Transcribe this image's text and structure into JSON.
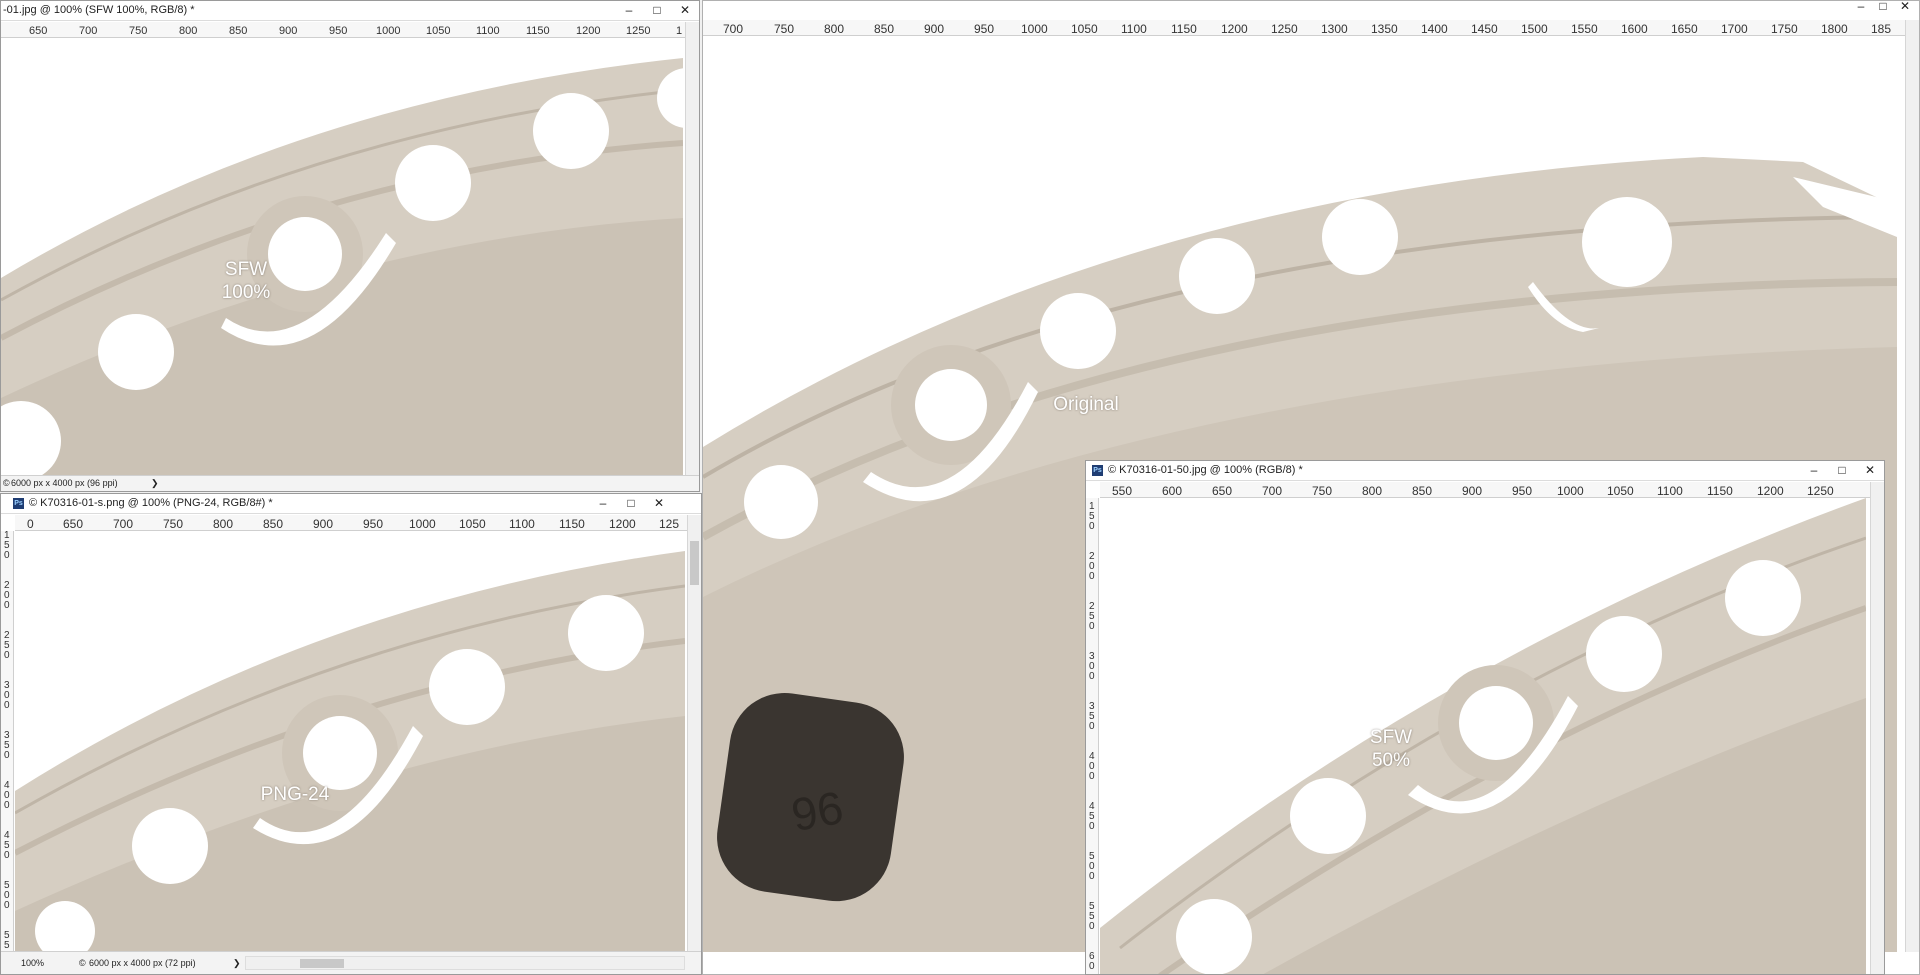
{
  "colors": {
    "metal": "#cfc6b9",
    "metal_light": "#ddd6cb",
    "metal_dark": "#b3a899",
    "hole": "#ffffff",
    "stamp": "#3a3530"
  },
  "win_top_left": {
    "title": "-01.jpg @ 100% (SFW 100%, RGB/8) *",
    "ruler_x": [
      "650",
      "700",
      "750",
      "800",
      "850",
      "900",
      "950",
      "1000",
      "1050",
      "1100",
      "1150",
      "1200",
      "1250",
      "1"
    ],
    "status_size": "6000 px x 4000 px (96 ppi)",
    "status_arrow": "❯",
    "label": "SFW\n100%"
  },
  "win_main": {
    "ruler_x": [
      "700",
      "750",
      "800",
      "850",
      "900",
      "950",
      "1000",
      "1050",
      "1100",
      "1150",
      "1200",
      "1250",
      "1300",
      "1350",
      "1400",
      "1450",
      "1500",
      "1550",
      "1600",
      "1650",
      "1700",
      "1750",
      "1800",
      "185"
    ],
    "label": "Original",
    "stamp_text": "96"
  },
  "win_bottom_left": {
    "title": "K70316-01-s.png @ 100% (PNG-24, RGB/8#) *",
    "ruler_x": [
      "0",
      "650",
      "700",
      "750",
      "800",
      "850",
      "900",
      "950",
      "1000",
      "1050",
      "1100",
      "1150",
      "1200",
      "125"
    ],
    "ruler_y": [
      "1\n5\n0",
      "2\n0\n0",
      "2\n5\n0",
      "3\n0\n0",
      "3\n5\n0",
      "4\n0\n0",
      "4\n5\n0",
      "5\n0\n0",
      "5\n5"
    ],
    "zoom": "100%",
    "status_size": "6000 px x 4000 px (72 ppi)",
    "status_arrow": "❯",
    "label": "PNG-24"
  },
  "win_bottom_right": {
    "title": "K70316-01-50.jpg @ 100% (RGB/8) *",
    "ruler_x": [
      "550",
      "600",
      "650",
      "700",
      "750",
      "800",
      "850",
      "900",
      "950",
      "1000",
      "1050",
      "1100",
      "1150",
      "1200",
      "1250"
    ],
    "ruler_y": [
      "1\n5\n0",
      "2\n0\n0",
      "2\n5\n0",
      "3\n0\n0",
      "3\n5\n0",
      "4\n0\n0",
      "4\n5\n0",
      "5\n0\n0",
      "5\n5\n0",
      "6\n0"
    ],
    "label": "SFW\n50%"
  },
  "controls": {
    "minimize": "–",
    "maximize": "□",
    "close": "✕"
  },
  "ps_icon": "Ps",
  "copyright": "©"
}
